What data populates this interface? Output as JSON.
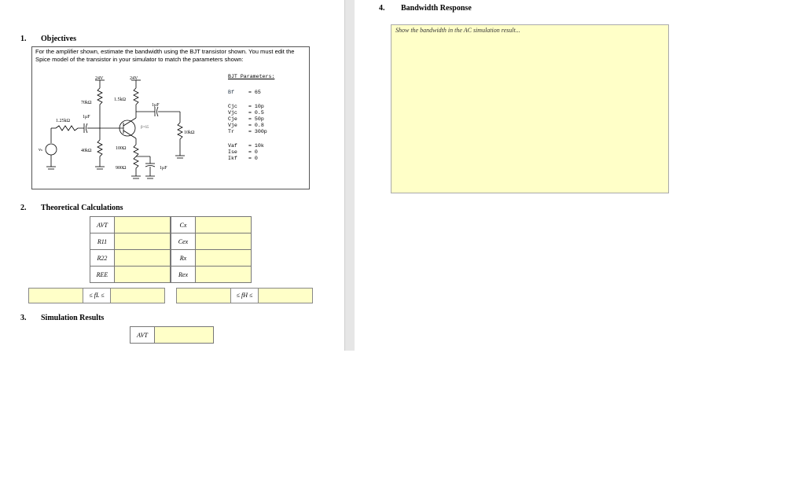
{
  "section1": {
    "num": "1.",
    "title": "Objectives",
    "text": "For the amplifier shown, estimate the bandwidth using the BJT transistor shown. You must edit the Spice model of the transistor in your simulator to match the parameters shown:"
  },
  "circuit": {
    "v1": "24V",
    "v2": "24V",
    "r70k": "70kΩ",
    "r15k": "1.5kΩ",
    "c1uf_top": "1μF",
    "r125k": "1.25kΩ",
    "c1uf_left": "1μF",
    "beta": "β=65",
    "r10k": "10kΩ",
    "vs": "vₛ",
    "r40k": "40kΩ",
    "r100": "100Ω",
    "r900": "900Ω",
    "c1uf_bot": "1μF"
  },
  "bjt_params": {
    "title": "BJT Parameters:",
    "rows": [
      {
        "name": "Bf",
        "value": "= 65"
      },
      {
        "name": "Cjc",
        "value": "= 10p"
      },
      {
        "name": "Vjc",
        "value": "= 0.5"
      },
      {
        "name": "Cje",
        "value": "= 50p"
      },
      {
        "name": "Vje",
        "value": "= 0.8"
      },
      {
        "name": "Tr",
        "value": "= 300p"
      },
      {
        "name": "Vaf",
        "value": "= 10k"
      },
      {
        "name": "Ise",
        "value": "= 0"
      },
      {
        "name": "Ikf",
        "value": "= 0"
      }
    ]
  },
  "section2": {
    "num": "2.",
    "title": "Theoretical Calculations",
    "left_labels": [
      "AVT",
      "R11",
      "R22",
      "REE"
    ],
    "right_labels": [
      "Cx",
      "Cex",
      "Rx",
      "Rex"
    ],
    "fl_label": "≤ fL ≤",
    "fh_label": "≤ fH ≤"
  },
  "section3": {
    "num": "3.",
    "title": "Simulation Results",
    "avt_label": "AVT"
  },
  "section4": {
    "num": "4.",
    "title": "Bandwidth Response",
    "placeholder": "Show the bandwidth in the AC simulation result..."
  }
}
